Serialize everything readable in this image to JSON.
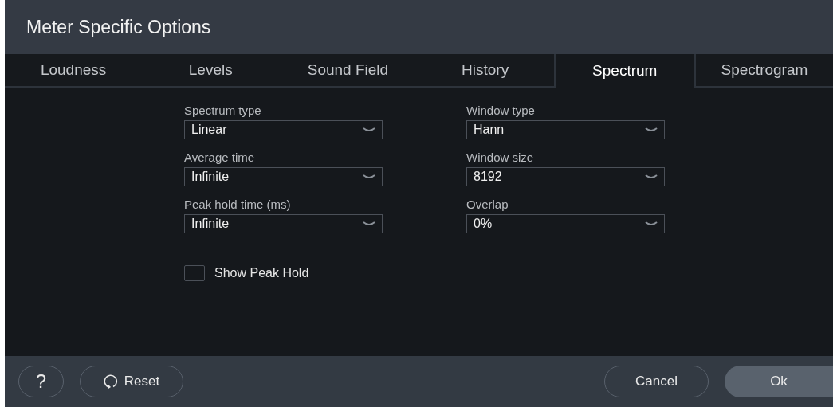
{
  "window": {
    "title": "Meter Specific Options"
  },
  "tabs": [
    {
      "label": "Loudness",
      "selected": false
    },
    {
      "label": "Levels",
      "selected": false
    },
    {
      "label": "Sound Field",
      "selected": false
    },
    {
      "label": "History",
      "selected": false
    },
    {
      "label": "Spectrum",
      "selected": true
    },
    {
      "label": "Spectrogram",
      "selected": false
    }
  ],
  "columns": [
    [
      {
        "label": "Spectrum type",
        "value": "Linear"
      },
      {
        "label": "Average time",
        "value": "Infinite"
      },
      {
        "label": "Peak hold time (ms)",
        "value": "Infinite"
      }
    ],
    [
      {
        "label": "Window type",
        "value": "Hann"
      },
      {
        "label": "Window size",
        "value": "8192"
      },
      {
        "label": "Overlap",
        "value": "0%"
      }
    ]
  ],
  "show_peak_hold": {
    "label": "Show Peak Hold",
    "checked": false
  },
  "footer": {
    "help": "?",
    "reset": "Reset",
    "cancel": "Cancel",
    "ok": "Ok"
  }
}
